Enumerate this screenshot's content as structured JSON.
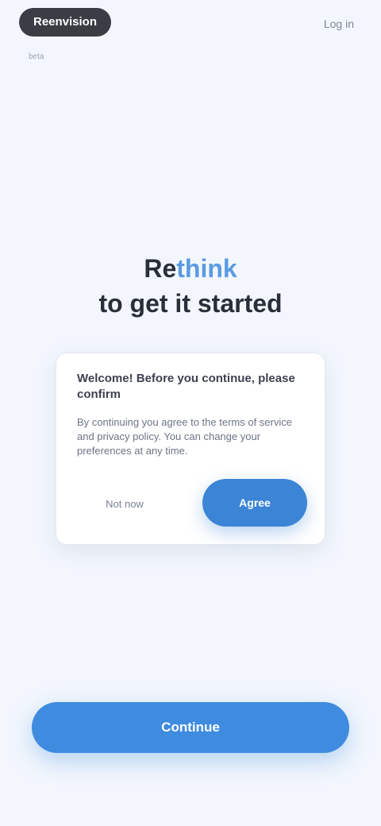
{
  "header": {
    "logo_text": "Reenvision",
    "logo_subtext": "beta",
    "top_link": "Log in"
  },
  "heading": {
    "line1_prefix": "Re",
    "line1_accent": "think",
    "line2": "to get it started"
  },
  "card": {
    "title": "Welcome! Before you continue, please confirm",
    "body": "By continuing you agree to the terms of service and privacy policy. You can change your preferences at any time.",
    "secondary_label": "Not now",
    "primary_label": "Agree"
  },
  "cta": {
    "label": "Continue"
  },
  "colors": {
    "background": "#f3f7fd",
    "accent": "#3f8be0",
    "heading_accent": "#5a9be3"
  }
}
